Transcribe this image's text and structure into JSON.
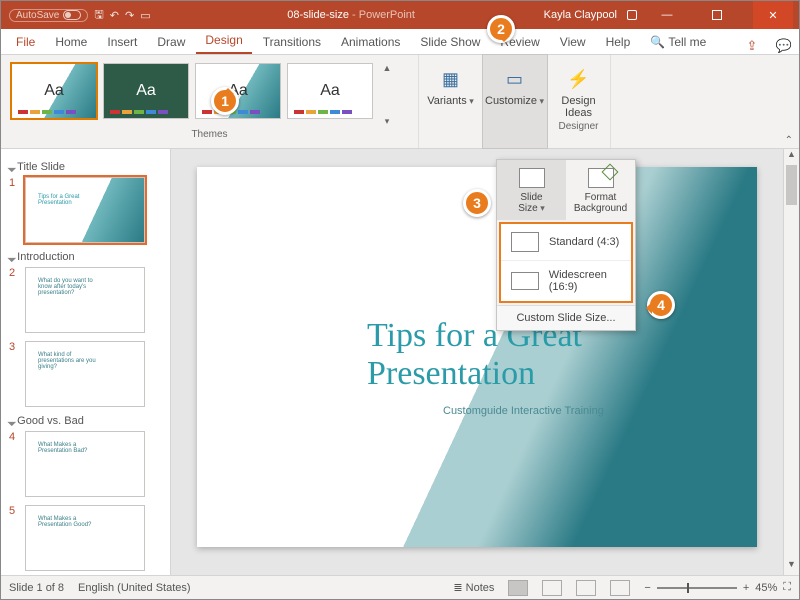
{
  "titlebar": {
    "autosave": "AutoSave",
    "filename": "08-slide-size",
    "appname": "PowerPoint",
    "user": "Kayla Claypool"
  },
  "tabs": {
    "file": "File",
    "home": "Home",
    "insert": "Insert",
    "draw": "Draw",
    "design": "Design",
    "transitions": "Transitions",
    "animations": "Animations",
    "slideshow": "Slide Show",
    "review": "Review",
    "view": "View",
    "help": "Help",
    "tellme": "Tell me"
  },
  "ribbon": {
    "themes_label": "Themes",
    "theme_sample": "Aa",
    "variants": "Variants",
    "customize": "Customize",
    "designer_group": "Designer",
    "design_ideas": "Design\nIdeas"
  },
  "popout": {
    "slide_size": "Slide\nSize",
    "format_bg": "Format\nBackground",
    "standard": "Standard (4:3)",
    "widescreen": "Widescreen (16:9)",
    "custom": "Custom Slide Size..."
  },
  "sections": {
    "s1": "Title Slide",
    "s2": "Introduction",
    "s3": "Good vs. Bad"
  },
  "thumbs": {
    "n1": "1",
    "n2": "2",
    "n3": "3",
    "n4": "4",
    "n5": "5",
    "t1": "Tips for a Great Presentation",
    "t2": "What do you want to know after today's presentation?",
    "t3": "What kind of presentations are you giving?",
    "t4": "What Makes a Presentation Bad?",
    "t5": "What Makes a Presentation Good?"
  },
  "slide": {
    "title": "Tips for a Great Presentation",
    "subtitle": "Customguide Interactive Training"
  },
  "status": {
    "pos": "Slide 1 of 8",
    "lang": "English (United States)",
    "notes": "Notes",
    "zoom": "45%"
  },
  "callouts": {
    "c1": "1",
    "c2": "2",
    "c3": "3",
    "c4": "4"
  }
}
